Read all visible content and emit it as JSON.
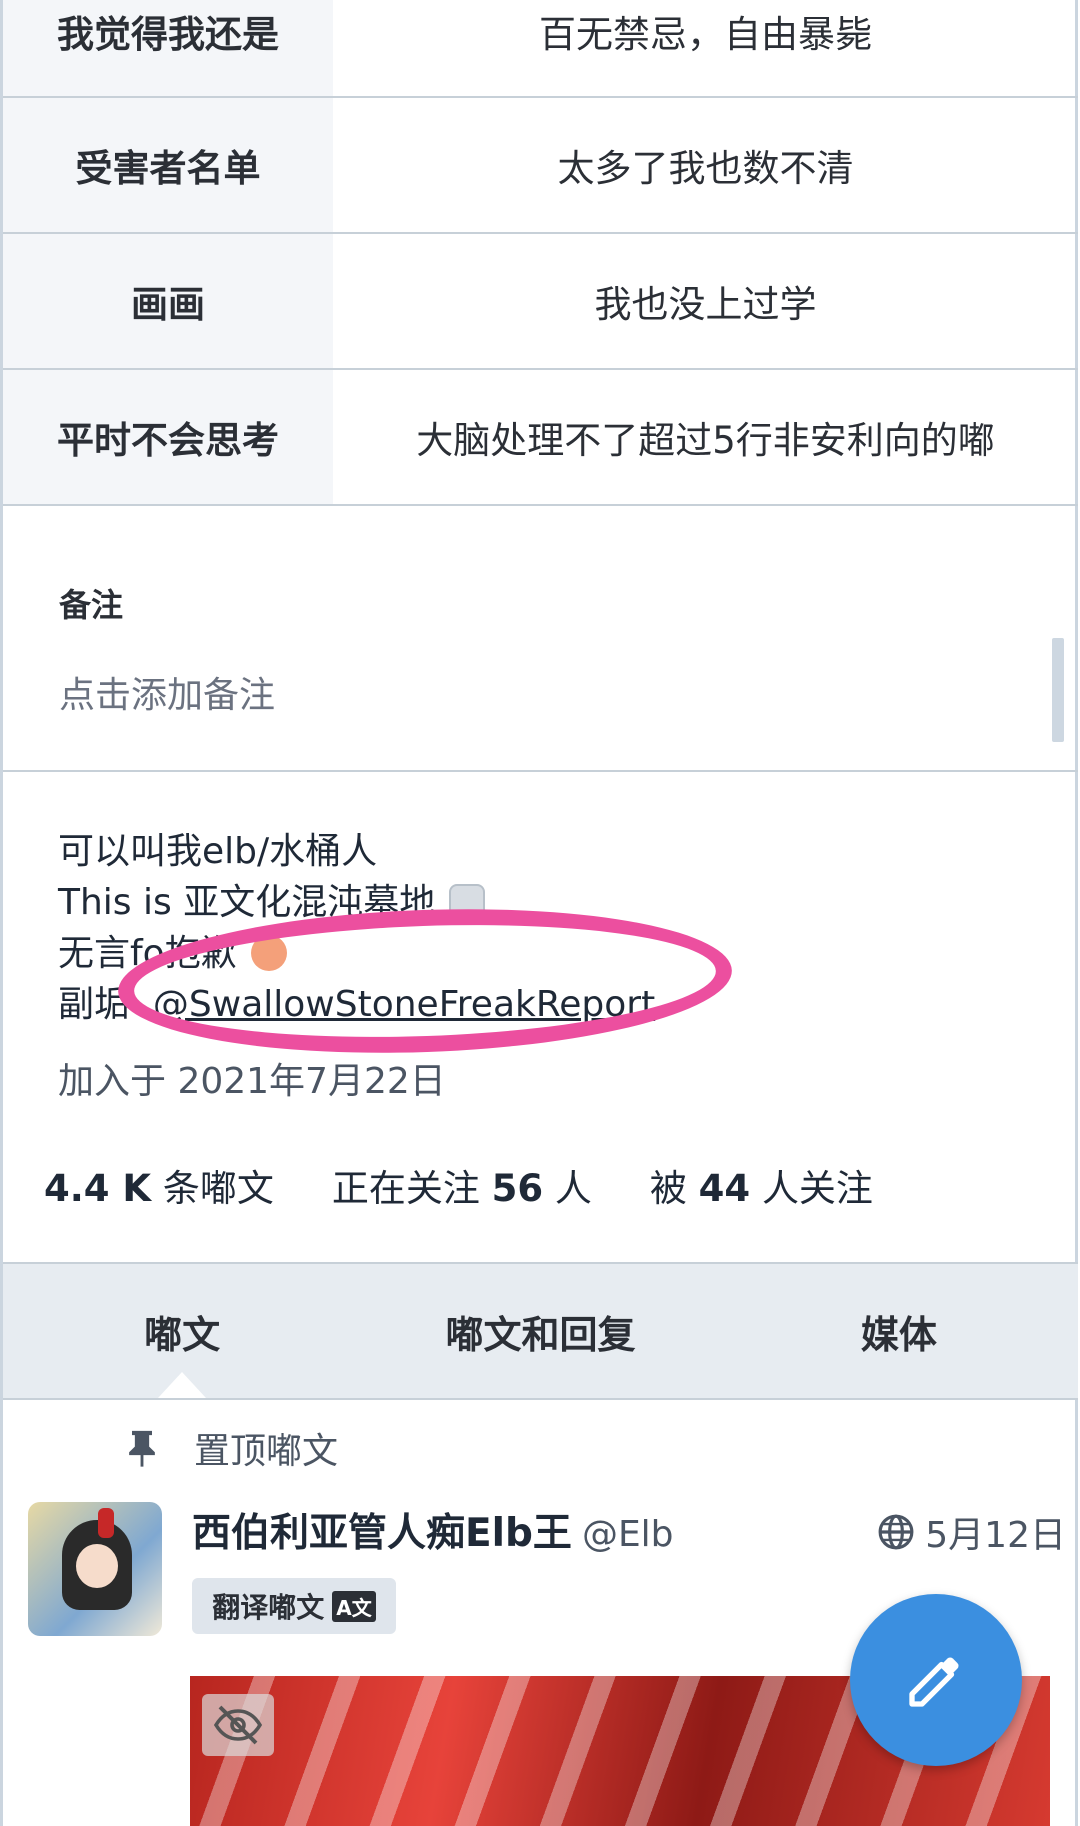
{
  "profile_fields": [
    {
      "name": "我觉得我还是",
      "value": "百无禁忌，自由暴毙"
    },
    {
      "name": "受害者名单",
      "value": "太多了我也数不清"
    },
    {
      "name": "画画",
      "value": "我也没上过学"
    },
    {
      "name": "平时不会思考",
      "value": "大脑处理不了超过5行非安利向的嘟"
    }
  ],
  "note": {
    "title": "备注",
    "placeholder": "点击添加备注"
  },
  "bio": {
    "line1": "可以叫我elb/水桶人",
    "line2": "This is 亚文化混沌墓地",
    "line3": "无言fo抱歉",
    "line4_prefix": "副垢",
    "line4_link": "@SwallowStoneFreakReport"
  },
  "joined": "加入于 2021年7月22日",
  "stats": {
    "posts_count": "4.4 K",
    "posts_label": "条嘟文",
    "following_prefix": "正在关注",
    "following_count": "56",
    "following_suffix": "人",
    "followers_prefix": "被",
    "followers_count": "44",
    "followers_suffix": "人关注"
  },
  "tabs": [
    "嘟文",
    "嘟文和回复",
    "媒体"
  ],
  "pinned_label": "置顶嘟文",
  "post": {
    "author_name": "西伯利亚管人痴Elb王",
    "handle": "@Elb",
    "date": "5月12日",
    "translate_label": "翻译嘟文"
  },
  "colors": {
    "annotation": "#ec4f9f",
    "fab": "#3b8fe0",
    "tab_bar": "#e7ecf1"
  },
  "icons": {
    "pin": "pin-icon",
    "globe": "globe-icon",
    "fab": "pencil-icon",
    "hide_media": "eye-off-icon"
  }
}
